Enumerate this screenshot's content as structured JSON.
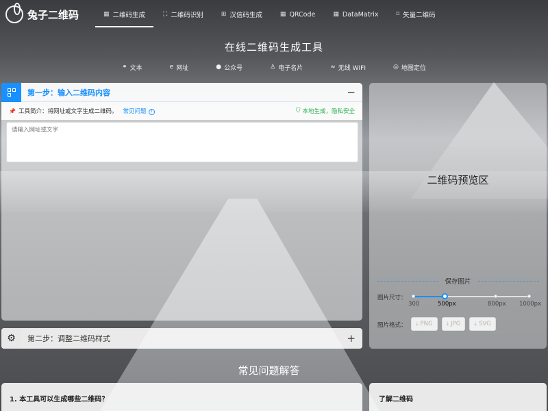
{
  "app": {
    "logo_text": "兔子二维码"
  },
  "nav": [
    {
      "icon": "qrcode-icon",
      "label": "二维码生成",
      "active": true
    },
    {
      "icon": "scan-icon",
      "label": "二维码识别",
      "active": false
    },
    {
      "icon": "hanxin-icon",
      "label": "汉信码生成",
      "active": false
    },
    {
      "icon": "qrcode-icon",
      "label": "QRCode",
      "active": false
    },
    {
      "icon": "datamatrix-icon",
      "label": "DataMatrix",
      "active": false
    },
    {
      "icon": "vector-icon",
      "label": "矢量二维码",
      "active": false
    }
  ],
  "page_title": "在线二维码生成工具",
  "type_tabs": [
    {
      "icon": "link-icon",
      "label": "文本"
    },
    {
      "icon": "browser-icon",
      "label": "网址"
    },
    {
      "icon": "wechat-icon",
      "label": "公众号"
    },
    {
      "icon": "user-icon",
      "label": "电子名片"
    },
    {
      "icon": "wifi-icon",
      "label": "无线 WIFI"
    },
    {
      "icon": "location-icon",
      "label": "地图定位"
    }
  ],
  "step1": {
    "title": "第一步：输入二维码内容",
    "collapse_symbol": "−",
    "intro": "工具简介：将网址或文字生成二维码。",
    "faq_link": "常见问题",
    "safe_text": "本地生成，隐私安全",
    "input_placeholder": "请输入网址或文字"
  },
  "step2": {
    "title": "第二步：调整二维码样式",
    "expand_symbol": "+"
  },
  "preview": {
    "label": "二维码预览区",
    "save_label": "保存图片",
    "size_label": "图片尺寸：",
    "size_marks": [
      "300",
      "500px",
      "800px",
      "1000px"
    ],
    "size_selected": "500px",
    "format_label": "图片格式：",
    "formats": [
      "PNG",
      "JPG",
      "SVG"
    ]
  },
  "faq": {
    "title": "常见问题解答",
    "q1": "1. 本工具可以生成哪些二维码？"
  },
  "learn": {
    "title": "了解二维码"
  }
}
